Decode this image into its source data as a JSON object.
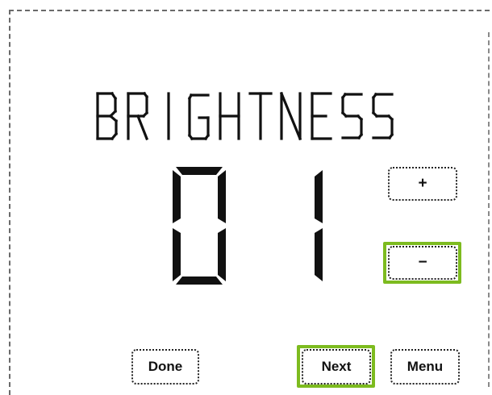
{
  "screen": {
    "title": "BRIGHTNESS",
    "value": "01"
  },
  "controls": {
    "increase_label": "+",
    "decrease_label": "−"
  },
  "footer": {
    "done_label": "Done",
    "next_label": "Next",
    "menu_label": "Menu"
  },
  "colors": {
    "highlight": "#7dbb1f",
    "lcd_segment": "#111111"
  }
}
